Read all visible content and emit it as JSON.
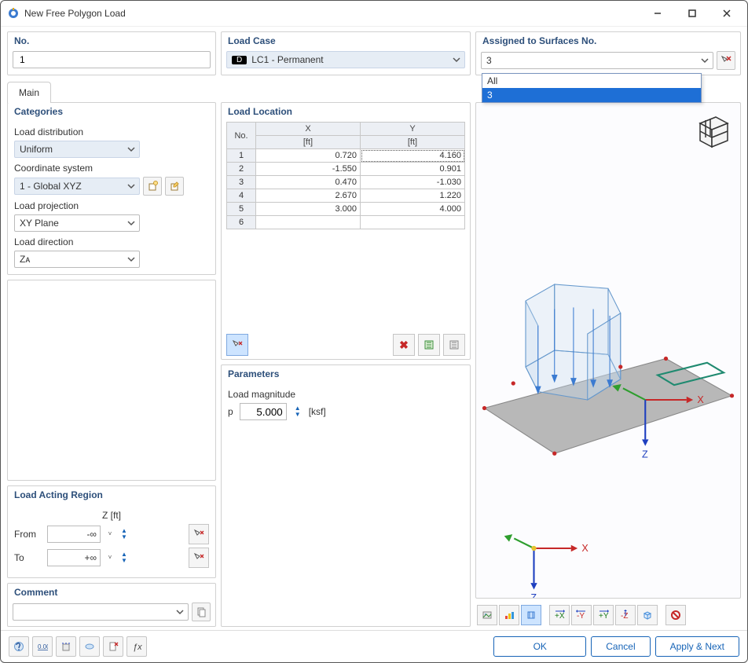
{
  "window": {
    "title": "New Free Polygon Load"
  },
  "top": {
    "no": {
      "header": "No.",
      "value": "1"
    },
    "loadcase": {
      "header": "Load Case",
      "badge": "D",
      "value": "LC1 - Permanent"
    },
    "assigned": {
      "header": "Assigned to Surfaces No.",
      "value": "3",
      "options": [
        "All",
        "3"
      ],
      "selected_index": 1
    }
  },
  "tabs": {
    "main": "Main"
  },
  "categories": {
    "header": "Categories",
    "load_distribution_label": "Load distribution",
    "load_distribution_value": "Uniform",
    "coordinate_system_label": "Coordinate system",
    "coordinate_system_value": "1 - Global XYZ",
    "load_projection_label": "Load projection",
    "load_projection_value": "XY Plane",
    "load_direction_label": "Load direction",
    "load_direction_value": "Zᴀ"
  },
  "acting": {
    "header": "Load Acting Region",
    "column_header": "Z [ft]",
    "from_label": "From",
    "from_value": "-∞",
    "to_label": "To",
    "to_value": "+∞"
  },
  "comment": {
    "header": "Comment",
    "value": ""
  },
  "location": {
    "header": "Load Location",
    "col_no": "No.",
    "col_x": "X",
    "col_y": "Y",
    "unit": "[ft]",
    "rows": [
      {
        "n": "1",
        "x": "0.720",
        "y": "4.160"
      },
      {
        "n": "2",
        "x": "-1.550",
        "y": "0.901"
      },
      {
        "n": "3",
        "x": "0.470",
        "y": "-1.030"
      },
      {
        "n": "4",
        "x": "2.670",
        "y": "1.220"
      },
      {
        "n": "5",
        "x": "3.000",
        "y": "4.000"
      },
      {
        "n": "6",
        "x": "",
        "y": ""
      }
    ]
  },
  "parameters": {
    "header": "Parameters",
    "load_magnitude_label": "Load magnitude",
    "p_symbol": "p",
    "p_value": "5.000",
    "p_unit": "[ksf]"
  },
  "viewport": {
    "x_label": "X",
    "z_label": "Z",
    "x2_label": "X",
    "z2_label": "Z"
  },
  "footer": {
    "ok": "OK",
    "cancel": "Cancel",
    "apply_next": "Apply & Next"
  }
}
